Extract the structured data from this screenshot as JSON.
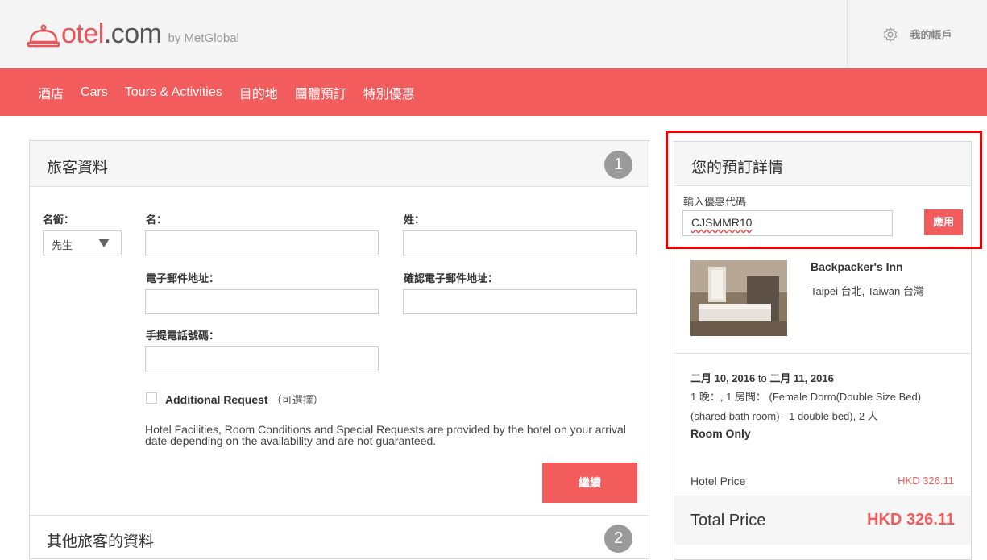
{
  "brand": {
    "otel": "otel",
    "dotcom": ".com",
    "by": "by MetGlobal",
    "color": "#f25c5c"
  },
  "account": {
    "label": "我的帳戶"
  },
  "nav": [
    "酒店",
    "Cars",
    "Tours & Activities",
    "目的地",
    "團體預訂",
    "特別優惠"
  ],
  "guest": {
    "title": "旅客資料",
    "step": "1",
    "salutation_label": "名銜：",
    "salutation_value": "先生",
    "first_name_label": "名：",
    "last_name_label": "姓：",
    "email_label": "電子郵件地址：",
    "confirm_email_label": "確認電子郵件地址：",
    "mobile_label": "手提電話號碼：",
    "request_label": "Additional Request",
    "request_optional": "（可選擇）",
    "notice": "Hotel Facilities, Room Conditions and Special Requests are provided by the hotel on your arrival date depending on the availability and are not guaranteed.",
    "continue": "繼續"
  },
  "other_guests": {
    "title": "其他旅客的資料",
    "step": "2"
  },
  "booking": {
    "title": "您的預訂詳情",
    "promo_label": "輸入優惠代碼",
    "promo_value": "CJSMMR10",
    "apply": "應用",
    "hotel_name": "Backpacker's Inn",
    "hotel_location": "Taipei 台北, Taiwan 台灣",
    "date_from": "二月 10, 2016",
    "date_to_word": "to",
    "date_to": "二月 11, 2016",
    "room_info": "1 晚：, 1 房間： (Female Dorm(Double Size Bed) (shared bath room) - 1 double bed), 2 人",
    "board": "Room Only",
    "hotel_price_label": "Hotel Price",
    "hotel_price": "HKD 326.11",
    "total_label": "Total Price",
    "total": "HKD 326.11"
  }
}
